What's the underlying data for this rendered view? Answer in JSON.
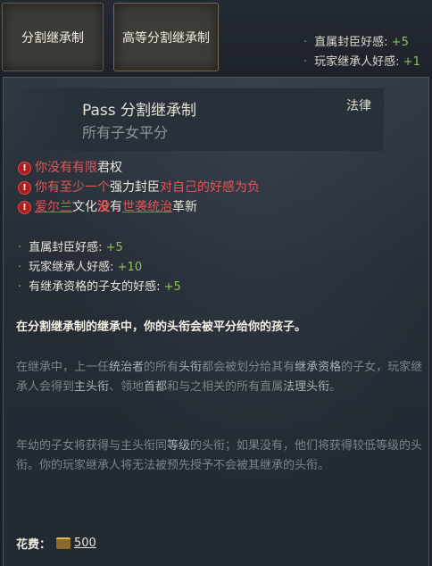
{
  "tabs": [
    {
      "label": "分割继承制"
    },
    {
      "label": "高等分割继承制"
    }
  ],
  "side_effects": [
    {
      "label": "直属封臣好感",
      "value": "+5"
    },
    {
      "label": "玩家继承人好感",
      "value": "+1"
    }
  ],
  "law": {
    "title": "Pass 分割继承制",
    "subtitle": "所有子女平分",
    "category": "法律"
  },
  "requirements": {
    "r1": {
      "a": "你没有有限",
      "b": "君权"
    },
    "r2": {
      "a": "你有至少一个",
      "b": "强力封臣",
      "c": "对自己的好感为负"
    },
    "r3": {
      "a": "爱尔兰",
      "b": "文化",
      "c": "没",
      "d": "有",
      "e": "世袭统治",
      "f": "革新"
    }
  },
  "effects": [
    {
      "label": "直属封臣好感: ",
      "value": "+5"
    },
    {
      "label": "玩家继承人好感: ",
      "value": "+10"
    },
    {
      "label": "有继承资格的子女的好感: ",
      "value": "+5"
    }
  ],
  "description_bold": "在分割继承制的继承中，你的头衔会被平分给你的孩子。",
  "description1": {
    "t1": "在继承中，上一任",
    "t2": "统治者",
    "t3": "的所有",
    "t4": "头衔",
    "t5": "都会被划分给其有",
    "t6": "继承资格",
    "t7": "的子女，玩家继承人会得到",
    "t8": "主头衔",
    "t9": "、领地",
    "t10": "首都",
    "t11": "和与之相关的所有直属",
    "t12": "法理头衔",
    "t13": "。"
  },
  "description2": {
    "t1": "年幼的子女将获得与主头衔同",
    "t2": "等级",
    "t3": "的头衔；如果没有，他们将获得较低等级的头衔。你的玩家继承人将无法被预先授予不会被其继承的头衔。"
  },
  "cost": {
    "label": "花费：",
    "value": "500",
    "icon": "prestige-icon"
  },
  "colors": {
    "positive": "#8cc05a",
    "negative": "#e05656",
    "warning": "#a82020"
  }
}
